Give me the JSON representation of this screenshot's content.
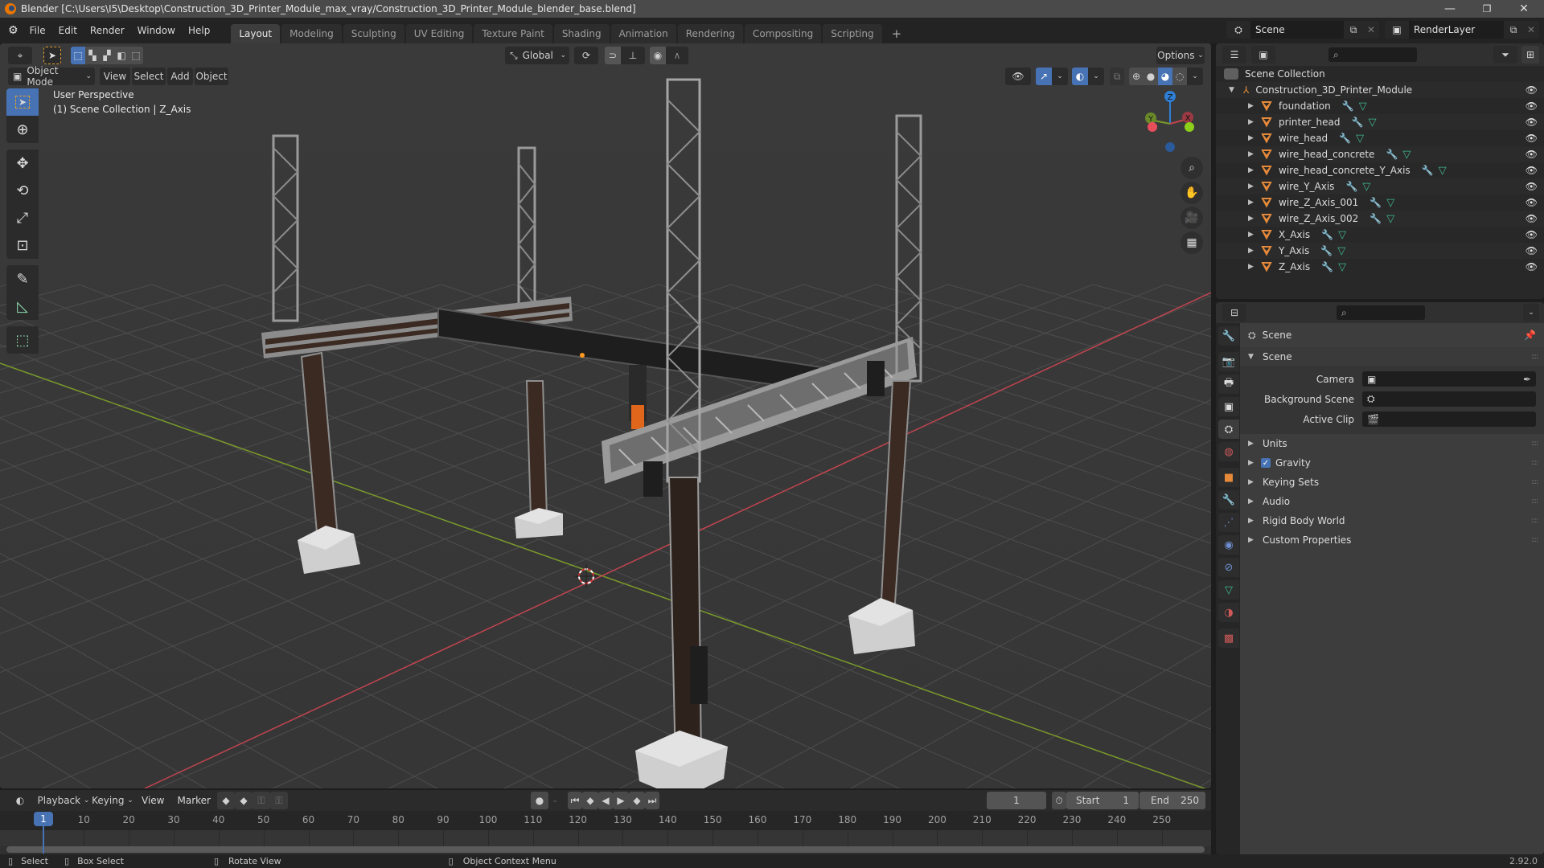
{
  "window": {
    "title": "Blender [C:\\Users\\I5\\Desktop\\Construction_3D_Printer_Module_max_vray/Construction_3D_Printer_Module_blender_base.blend]",
    "controls": {
      "minimize": "—",
      "maximize": "❐",
      "close": "✕"
    }
  },
  "menubar": {
    "items": [
      "File",
      "Edit",
      "Render",
      "Window",
      "Help"
    ]
  },
  "workspaces": {
    "tabs": [
      "Layout",
      "Modeling",
      "Sculpting",
      "UV Editing",
      "Texture Paint",
      "Shading",
      "Animation",
      "Rendering",
      "Compositing",
      "Scripting"
    ],
    "active": "Layout",
    "add_label": "+"
  },
  "scene_selector": {
    "value": "Scene"
  },
  "layer_selector": {
    "value": "RenderLayer"
  },
  "viewport": {
    "mode": "Object Mode",
    "menus": [
      "View",
      "Select",
      "Add",
      "Object"
    ],
    "transform_orientation": "Global",
    "options_label": "Options",
    "view_name": "User Perspective",
    "collection_info": "(1) Scene Collection | Z_Axis",
    "gizmo_axes": {
      "x": "X",
      "y": "Y",
      "z": "Z"
    },
    "colors": {
      "x_axis": "#c2444f",
      "y_axis": "#7a9a2a",
      "z_axis": "#2f7fd6",
      "background": "#393939",
      "grid": "#4a4a4a"
    }
  },
  "toolbar": {
    "tools": [
      "select-box",
      "cursor",
      "move",
      "rotate",
      "scale",
      "transform",
      "annotate",
      "measure",
      "add-cube"
    ],
    "active": "select-box"
  },
  "outliner": {
    "root": "Scene Collection",
    "collection": "Construction_3D_Printer_Module",
    "objects": [
      "foundation",
      "printer_head",
      "wire_head",
      "wire_head_concrete",
      "wire_head_concrete_Y_Axis",
      "wire_Y_Axis",
      "wire_Z_Axis_001",
      "wire_Z_Axis_002",
      "X_Axis",
      "Y_Axis",
      "Z_Axis"
    ],
    "active_object": "Z_Axis"
  },
  "properties": {
    "context": "Scene",
    "section": "Scene",
    "fields": [
      {
        "label": "Camera",
        "value": ""
      },
      {
        "label": "Background Scene",
        "value": ""
      },
      {
        "label": "Active Clip",
        "value": ""
      }
    ],
    "panels": [
      {
        "label": "Units",
        "checkbox": false
      },
      {
        "label": "Gravity",
        "checkbox": true,
        "checked": true
      },
      {
        "label": "Keying Sets",
        "checkbox": false
      },
      {
        "label": "Audio",
        "checkbox": false
      },
      {
        "label": "Rigid Body World",
        "checkbox": false
      },
      {
        "label": "Custom Properties",
        "checkbox": false
      }
    ],
    "tabs": [
      "tool",
      "render",
      "output",
      "view-layer",
      "scene",
      "world",
      "object",
      "modifiers",
      "particles",
      "physics",
      "constraints",
      "data",
      "material",
      "texture"
    ],
    "active_tab": "scene"
  },
  "timeline": {
    "menus": [
      "Playback",
      "Keying",
      "View",
      "Marker"
    ],
    "current_frame": "1",
    "start_label": "Start",
    "start": "1",
    "end_label": "End",
    "end": "250",
    "ticks": [
      "10",
      "20",
      "30",
      "40",
      "50",
      "60",
      "70",
      "80",
      "90",
      "100",
      "110",
      "120",
      "130",
      "140",
      "150",
      "160",
      "170",
      "180",
      "190",
      "200",
      "210",
      "220",
      "230",
      "240",
      "250"
    ],
    "playhead": "1"
  },
  "statusbar": {
    "hints": [
      "Select",
      "Box Select",
      "Rotate View",
      "Object Context Menu"
    ],
    "version": "2.92.0"
  }
}
